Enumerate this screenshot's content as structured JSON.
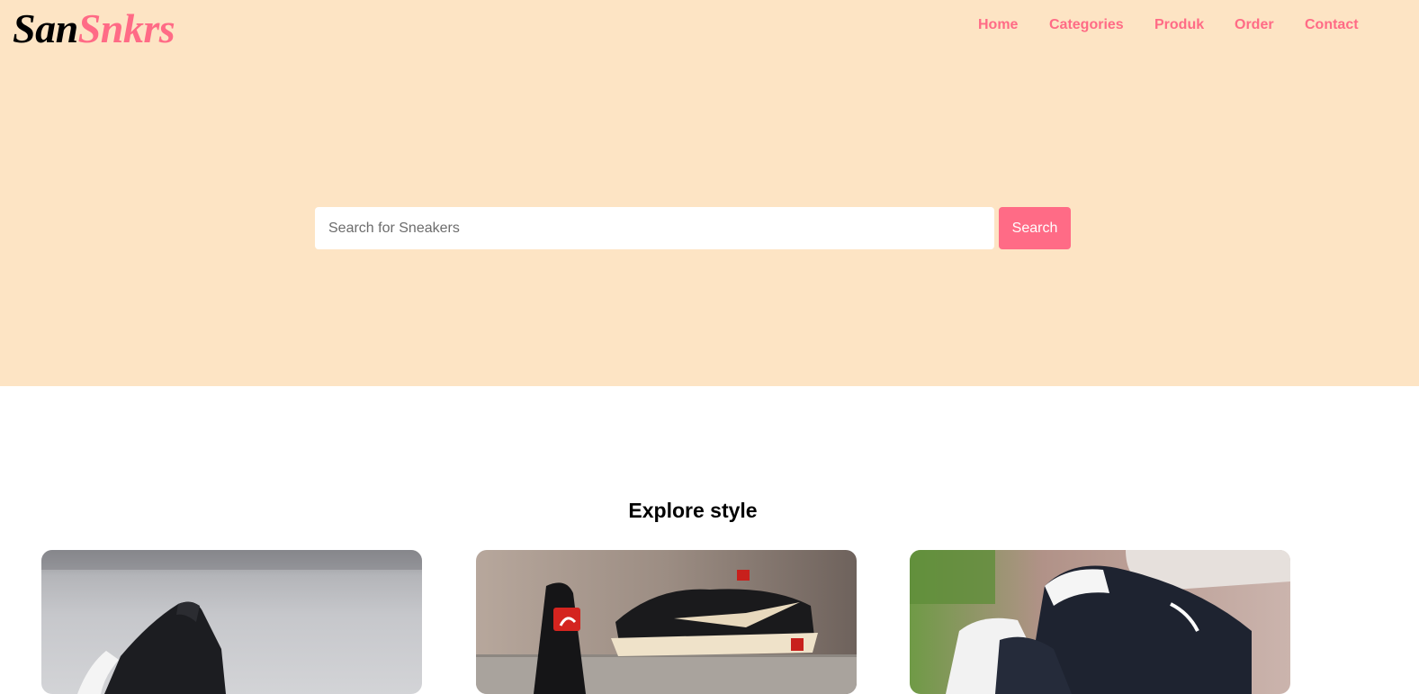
{
  "brand": {
    "part1": "San",
    "part2": "Snkrs"
  },
  "nav": {
    "items": [
      {
        "label": "Home"
      },
      {
        "label": "Categories"
      },
      {
        "label": "Produk"
      },
      {
        "label": "Order"
      },
      {
        "label": "Contact"
      }
    ]
  },
  "search": {
    "placeholder": "Search for Sneakers",
    "button_label": "Search"
  },
  "explore": {
    "title": "Explore style",
    "cards": [
      {
        "image": "black-white-sneaker-photo"
      },
      {
        "image": "black-sneakers-on-stone-photo"
      },
      {
        "image": "white-navy-sneakers-photo"
      }
    ]
  },
  "colors": {
    "accent": "#ff6b86",
    "hero_bg": "#fde4c4",
    "text": "#000000"
  }
}
